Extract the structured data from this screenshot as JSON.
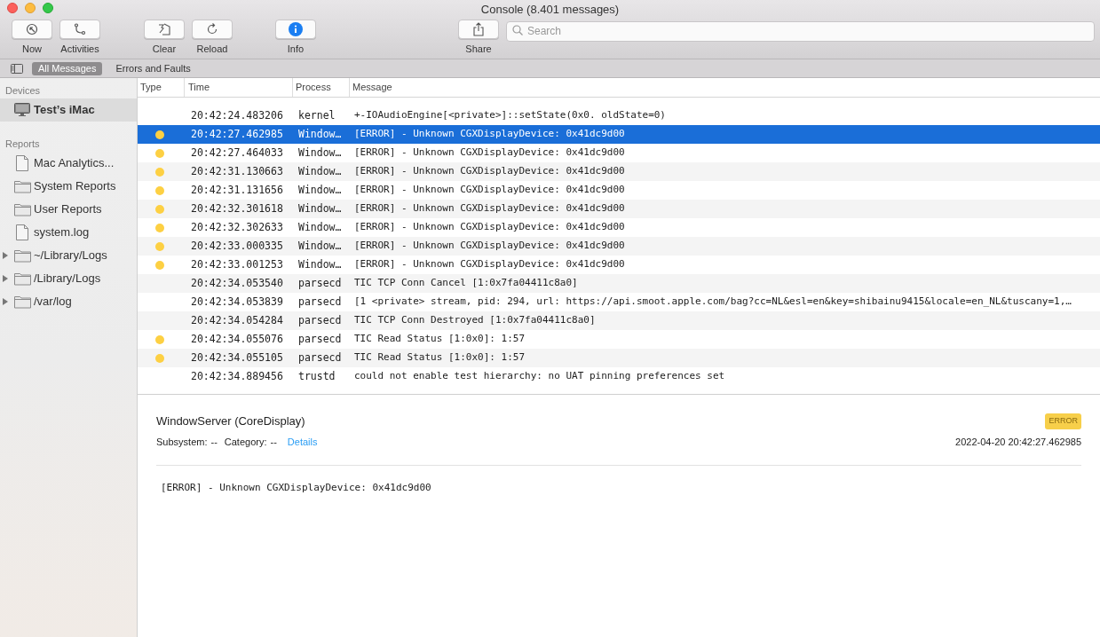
{
  "window": {
    "title": "Console (8.401 messages)"
  },
  "toolbar": {
    "buttons": [
      {
        "label": "Now",
        "kind": "now"
      },
      {
        "label": "Activities",
        "kind": "activities"
      },
      {
        "label": "Clear",
        "kind": "clear"
      },
      {
        "label": "Reload",
        "kind": "reload"
      },
      {
        "label": "Info",
        "kind": "info"
      },
      {
        "label": "Share",
        "kind": "share"
      }
    ],
    "search": {
      "placeholder": "Search"
    }
  },
  "filter_bar": {
    "tabs": [
      {
        "label": "All Messages",
        "selected": true
      },
      {
        "label": "Errors and Faults",
        "selected": false
      }
    ]
  },
  "sidebar": {
    "sections": [
      {
        "title": "Devices",
        "items": [
          {
            "label": "Test’s iMac",
            "kind": "device",
            "selected": true
          }
        ]
      },
      {
        "title": "Reports",
        "items": [
          {
            "label": "Mac Analytics...",
            "kind": "document",
            "selected": false
          },
          {
            "label": "System Reports",
            "kind": "folder",
            "selected": false
          },
          {
            "label": "User Reports",
            "kind": "folder",
            "selected": false
          },
          {
            "label": "system.log",
            "kind": "document",
            "selected": false
          },
          {
            "label": "~/Library/Logs",
            "kind": "folder",
            "selected": false,
            "expanded": false
          },
          {
            "label": "/Library/Logs",
            "kind": "folder",
            "selected": false,
            "expanded": false
          },
          {
            "label": "/var/log",
            "kind": "folder",
            "selected": false,
            "expanded": false
          }
        ]
      }
    ]
  },
  "table": {
    "columns": [
      "Type",
      "Time",
      "Process",
      "Message"
    ],
    "rows": [
      {
        "error": false,
        "time": "20:42:24.483206",
        "process": "kernel",
        "message": "+-IOAudioEngine[<private>]::setState(0x0. oldState=0)",
        "selected": false
      },
      {
        "error": true,
        "time": "20:42:27.462985",
        "process": "Window…",
        "message": "[ERROR] - Unknown CGXDisplayDevice: 0x41dc9d00",
        "selected": true
      },
      {
        "error": true,
        "time": "20:42:27.464033",
        "process": "Window…",
        "message": "[ERROR] - Unknown CGXDisplayDevice: 0x41dc9d00",
        "selected": false
      },
      {
        "error": true,
        "time": "20:42:31.130663",
        "process": "Window…",
        "message": "[ERROR] - Unknown CGXDisplayDevice: 0x41dc9d00",
        "selected": false
      },
      {
        "error": true,
        "time": "20:42:31.131656",
        "process": "Window…",
        "message": "[ERROR] - Unknown CGXDisplayDevice: 0x41dc9d00",
        "selected": false
      },
      {
        "error": true,
        "time": "20:42:32.301618",
        "process": "Window…",
        "message": "[ERROR] - Unknown CGXDisplayDevice: 0x41dc9d00",
        "selected": false
      },
      {
        "error": true,
        "time": "20:42:32.302633",
        "process": "Window…",
        "message": "[ERROR] - Unknown CGXDisplayDevice: 0x41dc9d00",
        "selected": false
      },
      {
        "error": true,
        "time": "20:42:33.000335",
        "process": "Window…",
        "message": "[ERROR] - Unknown CGXDisplayDevice: 0x41dc9d00",
        "selected": false
      },
      {
        "error": true,
        "time": "20:42:33.001253",
        "process": "Window…",
        "message": "[ERROR] - Unknown CGXDisplayDevice: 0x41dc9d00",
        "selected": false
      },
      {
        "error": false,
        "time": "20:42:34.053540",
        "process": "parsecd",
        "message": "TIC TCP Conn Cancel [1:0x7fa04411c8a0]",
        "selected": false
      },
      {
        "error": false,
        "time": "20:42:34.053839",
        "process": "parsecd",
        "message": "[1 <private> stream, pid: 294, url: https://api.smoot.apple.com/bag?cc=NL&esl=en&key=shibainu9415&locale=en_NL&tuscany=1,…",
        "selected": false
      },
      {
        "error": false,
        "time": "20:42:34.054284",
        "process": "parsecd",
        "message": "TIC TCP Conn Destroyed [1:0x7fa04411c8a0]",
        "selected": false
      },
      {
        "error": true,
        "time": "20:42:34.055076",
        "process": "parsecd",
        "message": "TIC Read Status [1:0x0]: 1:57",
        "selected": false
      },
      {
        "error": true,
        "time": "20:42:34.055105",
        "process": "parsecd",
        "message": "TIC Read Status [1:0x0]: 1:57",
        "selected": false
      },
      {
        "error": false,
        "time": "20:42:34.889456",
        "process": "trustd",
        "message": "could not enable test hierarchy: no UAT pinning preferences set",
        "selected": false
      }
    ]
  },
  "detail": {
    "title": "WindowServer (CoreDisplay)",
    "badge": "ERROR",
    "subsystem_label": "Subsystem:",
    "subsystem": "--",
    "category_label": "Category:",
    "category": "--",
    "link": "Details",
    "timestamp": "2022-04-20 20:42:27.462985",
    "message": "[ERROR] - Unknown CGXDisplayDevice: 0x41dc9d00"
  }
}
